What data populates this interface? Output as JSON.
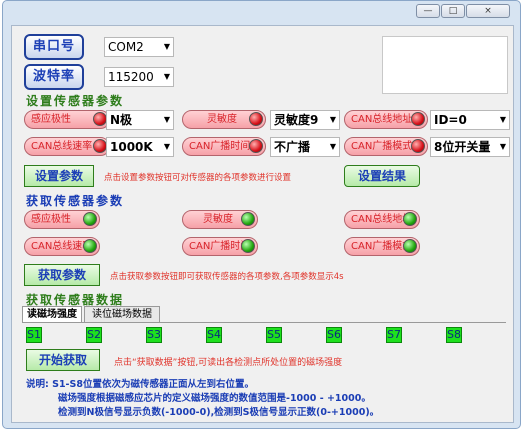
{
  "colors": {
    "accent": "#1c3fb6",
    "section_green": "#2e7d1b",
    "section_blue": "#1a3db5",
    "hint_red": "#e0332a",
    "led_red": "#d8121a",
    "led_green": "#23a80f",
    "s_box": "#1ee01e"
  },
  "window": {
    "buttons": [
      "—",
      "□",
      "×"
    ]
  },
  "serial": {
    "port_button": "串口号",
    "port_value": "COM2",
    "baud_button": "波特率",
    "baud_value": "115200"
  },
  "set_section": {
    "title": "设置传感器参数",
    "row1": {
      "btn1": "感应极性",
      "combo1": "N极",
      "btn2": "灵敏度",
      "combo2": "灵敏度9",
      "btn3": "CAN总线地址",
      "combo3": "ID=0"
    },
    "row2": {
      "btn1": "CAN总线速率",
      "combo1": "1000K",
      "btn2": "CAN广播时间",
      "combo2": "不广播",
      "btn3": "CAN广播模式",
      "combo3": "8位开关量"
    },
    "set_button": "设置参数",
    "hint": "点击设置参数按钮可对传感器的各项参数进行设置",
    "result_button": "设置结果"
  },
  "get_section": {
    "title": "获取传感器参数",
    "row1": [
      "感应极性",
      "灵敏度",
      "CAN总线地址"
    ],
    "row2": [
      "CAN总线速率",
      "CAN广播时间",
      "CAN广播模式"
    ],
    "get_button": "获取参数",
    "hint": "点击获取参数按钮即可获取传感器的各项参数,各项参数显示4s"
  },
  "data_section": {
    "title": "获取传感器数据",
    "tabs": [
      "读磁场强度",
      "读位磁场数据"
    ],
    "sensors": [
      "S1",
      "S2",
      "S3",
      "S4",
      "S5",
      "S6",
      "S7",
      "S8"
    ],
    "start_button": "开始获取",
    "hint": "点击“获取数据”按钮,可读出各检测点所处位置的磁场强度",
    "notes": [
      "说明: S1-S8位置依次为磁传感器正面从左到右位置。",
      "磁场强度根据磁感应芯片的定义磁场强度的数值范围是-1000 - +1000。",
      "检测到N极信号显示负数(-1000-0),检测到S极信号显示正数(0-+1000)。"
    ]
  }
}
